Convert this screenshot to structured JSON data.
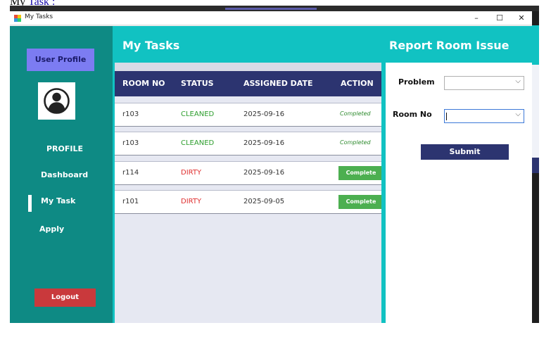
{
  "doc_link": {
    "prefix": "My ",
    "link": "Task :"
  },
  "window": {
    "title": "My Tasks",
    "minimize": "–",
    "maximize": "☐",
    "close": "✕"
  },
  "sidebar": {
    "profile_button": "User Profile",
    "profile_label": "PROFILE",
    "nav": [
      {
        "label": "Dashboard"
      },
      {
        "label": "My Task",
        "active": true
      },
      {
        "label": "Apply"
      }
    ],
    "logout": "Logout"
  },
  "tasks": {
    "title": "My Tasks",
    "columns": [
      "ROOM NO",
      "STATUS",
      "ASSIGNED DATE",
      "ACTION"
    ],
    "rows": [
      {
        "room": "r103",
        "status": "CLEANED",
        "date": "2025-09-16",
        "action": "Completed"
      },
      {
        "room": "r103",
        "status": "CLEANED",
        "date": "2025-09-16",
        "action": "Completed"
      },
      {
        "room": "r114",
        "status": "DIRTY",
        "date": "2025-09-16",
        "action": "Complete"
      },
      {
        "room": "r101",
        "status": "DIRTY",
        "date": "2025-09-05",
        "action": "Complete"
      }
    ]
  },
  "report": {
    "title": "Report Room Issue",
    "problem_label": "Problem",
    "problem_value": "",
    "room_label": "Room No",
    "room_value": "",
    "submit": "Submit"
  },
  "colors": {
    "sidebar": "#0e8a84",
    "panel": "#11c2c2",
    "header": "#2c3470",
    "profile_button": "#7c7cf2",
    "logout": "#c9393c",
    "complete_button": "#4caf50",
    "cleaned": "#2e9e2e",
    "dirty": "#e03030"
  }
}
